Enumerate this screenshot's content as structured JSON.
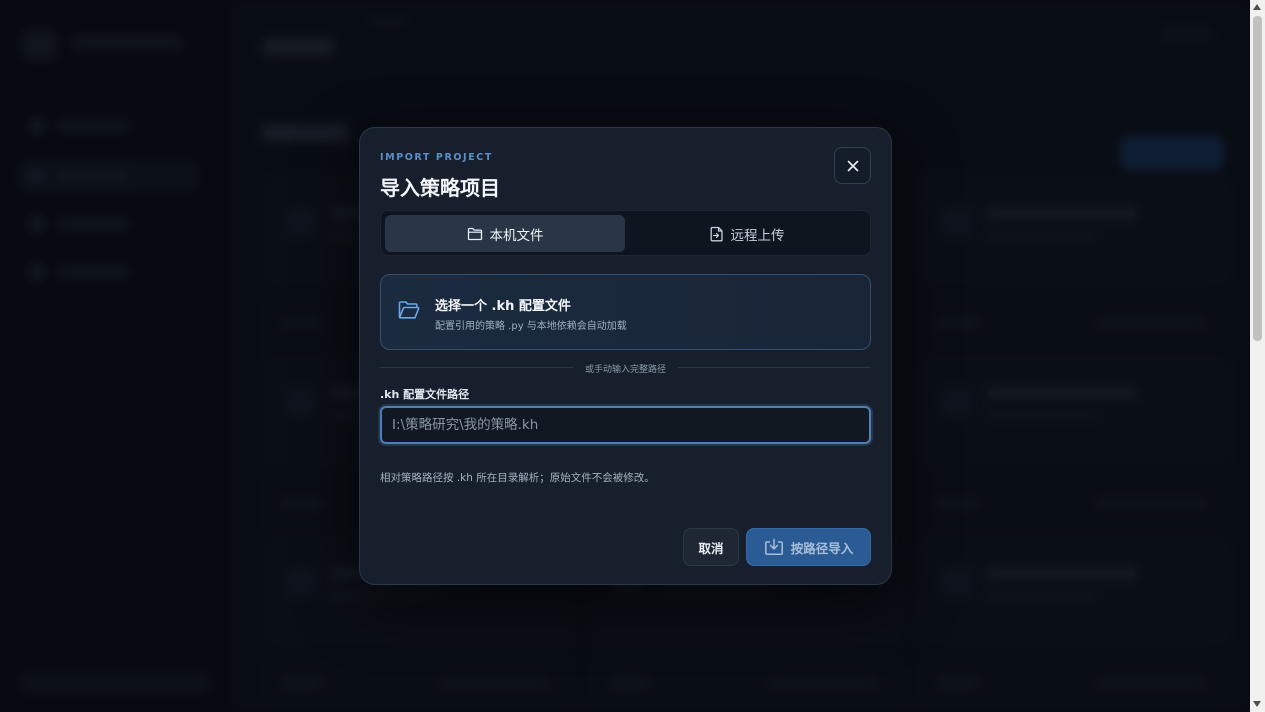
{
  "modal": {
    "eyebrow": "IMPORT PROJECT",
    "title": "导入策略项目",
    "tabs": [
      {
        "label": "本机文件",
        "icon": "folder-icon",
        "active": true
      },
      {
        "label": "远程上传",
        "icon": "file-upload-icon",
        "active": false
      }
    ],
    "file_picker": {
      "title": "选择一个 .kh 配置文件",
      "description": "配置引用的策略 .py 与本地依赖会自动加载",
      "icon": "folder-open-icon"
    },
    "divider_text": "或手动输入完整路径",
    "path_field": {
      "label": ".kh 配置文件路径",
      "value": "",
      "placeholder": "I:\\策略研究\\我的策略.kh"
    },
    "hint": "相对策略路径按 .kh 所在目录解析；原始文件不会被修改。",
    "buttons": {
      "cancel": "取消",
      "import": "按路径导入"
    }
  },
  "colors": {
    "accent": "#5b8fc9",
    "primary_button": "#2b5b94",
    "modal_background": "#161f2b",
    "page_background": "#0b1018"
  }
}
